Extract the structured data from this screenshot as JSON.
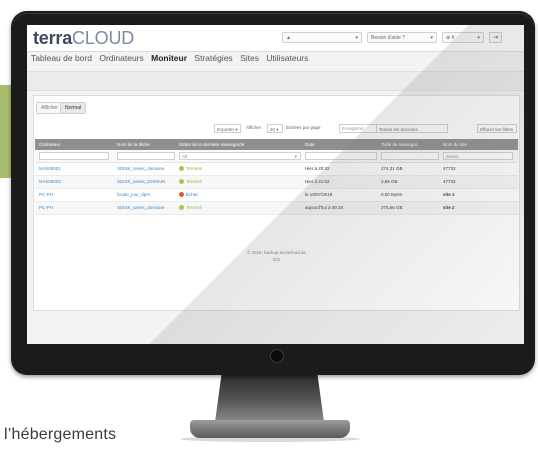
{
  "caption": "l’hébergements",
  "app": {
    "logo_bold": "terra",
    "logo_light": "CLOUD",
    "user_menu": "▲",
    "help_menu": "Besoin d'aide ?",
    "lang_menu": "⊕ fr",
    "exit_icon": "⇥"
  },
  "nav": {
    "items": [
      "Tableau de bord",
      "Ordinateurs",
      "Moniteur",
      "Stratégies",
      "Sites",
      "Utilisateurs"
    ],
    "active": "Moniteur"
  },
  "tabs": [
    "Afficher",
    "Normal"
  ],
  "controls": {
    "export": "Exporter",
    "show_label": "Afficher",
    "page_size": "20",
    "per_page_label": "Entrées par page",
    "filter_placeholder": "Enregistrer",
    "all_columns": "Toutes les données",
    "clear_filters": "Effacer les filtres"
  },
  "table": {
    "headers": [
      "Ordinateur",
      "Nom de la tâche",
      "Statut de la dernière sauvegarde",
      "Date",
      "Taille de sauvegar...",
      "Nom du site"
    ],
    "status_filter": "All",
    "site_filter": "Select",
    "rows": [
      {
        "computer": "NAS00001",
        "task": "SDISK_saves_domaine",
        "status": "Terminé",
        "status_kind": "ok",
        "date": "Hier à 20:42",
        "size": "274,31 GB",
        "site": "47733"
      },
      {
        "computer": "NAS00003",
        "task": "SDISK_saves_DOMAIN",
        "status": "Terminé",
        "status_kind": "ok",
        "date": "Hier à 21:02",
        "size": "2,66 GB",
        "site": "47733"
      },
      {
        "computer": "PC-PH",
        "task": "locale_jour_dpm",
        "status": "Échec",
        "status_kind": "err",
        "date": "le 19/07/2019",
        "size": "0,00 Bytes",
        "site": "site 1"
      },
      {
        "computer": "PC-PH",
        "task": "SDISK_saves_domaine",
        "status": "Terminé",
        "status_kind": "ok",
        "date": "aujourd'hui à 00:34",
        "size": "375,66 GB",
        "site": "site 2"
      }
    ]
  },
  "footer": {
    "line1": "© 2018, backup.terracloud.de",
    "line2": "001"
  }
}
